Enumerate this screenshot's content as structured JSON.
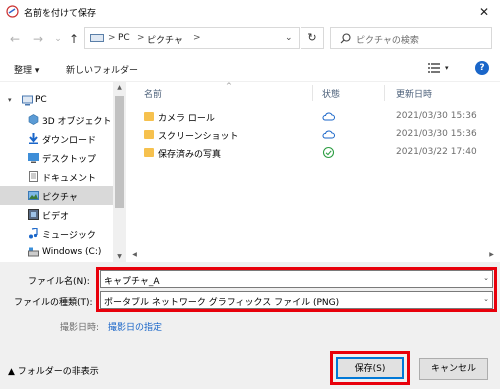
{
  "window": {
    "title": "名前を付けて保存",
    "close": "✕"
  },
  "navigation": {
    "back": "←",
    "forward": "→",
    "recent": "⌄",
    "up": "↑",
    "breadcrumb": [
      "PC",
      "ピクチャ"
    ],
    "separator": ">",
    "address_dropdown": "⌄",
    "refresh": "↻",
    "search_placeholder": "ピクチャの検索"
  },
  "toolbar": {
    "organize": "整理 ▾",
    "new_folder": "新しいフォルダー",
    "view_dropdown": "▾",
    "help": "?"
  },
  "sidebar": {
    "items": [
      {
        "label": "PC",
        "icon": "computer-icon",
        "expander": "▾",
        "selected": false
      },
      {
        "label": "3D オブジェクト",
        "icon": "3d-objects-icon",
        "selected": false
      },
      {
        "label": "ダウンロード",
        "icon": "download-icon",
        "selected": false
      },
      {
        "label": "デスクトップ",
        "icon": "desktop-icon",
        "selected": false
      },
      {
        "label": "ドキュメント",
        "icon": "document-icon",
        "selected": false
      },
      {
        "label": "ピクチャ",
        "icon": "pictures-icon",
        "selected": true
      },
      {
        "label": "ビデオ",
        "icon": "video-icon",
        "selected": false
      },
      {
        "label": "ミュージック",
        "icon": "music-icon",
        "selected": false
      },
      {
        "label": "Windows (C:)",
        "icon": "drive-icon",
        "selected": false
      }
    ]
  },
  "files": {
    "columns": {
      "name": "名前",
      "status": "状態",
      "modified": "更新日時"
    },
    "rows": [
      {
        "name": "カメラ ロール",
        "status": "cloud-icon",
        "modified": "2021/03/30 15:36"
      },
      {
        "name": "スクリーンショット",
        "status": "cloud-icon",
        "modified": "2021/03/30 15:36"
      },
      {
        "name": "保存済みの写真",
        "status": "synced-check-icon",
        "modified": "2021/03/22 17:40"
      }
    ]
  },
  "form": {
    "filename_label": "ファイル名(N):",
    "filename_value": "キャプチャ_A",
    "filetype_label": "ファイルの種類(T):",
    "filetype_value": "ポータブル ネットワーク グラフィックス ファイル (PNG)",
    "dropdown_arrow": "⌄",
    "date_taken_label": "撮影日時:",
    "date_taken_link": "撮影日の指定"
  },
  "footer": {
    "hide_folders": "▲ フォルダーの非表示",
    "save": "保存(S)",
    "cancel": "キャンセル"
  },
  "colors": {
    "highlight": "#e8000b",
    "accent": "#0078d7",
    "folder": "#f6c14e",
    "link": "#1a66c9"
  }
}
